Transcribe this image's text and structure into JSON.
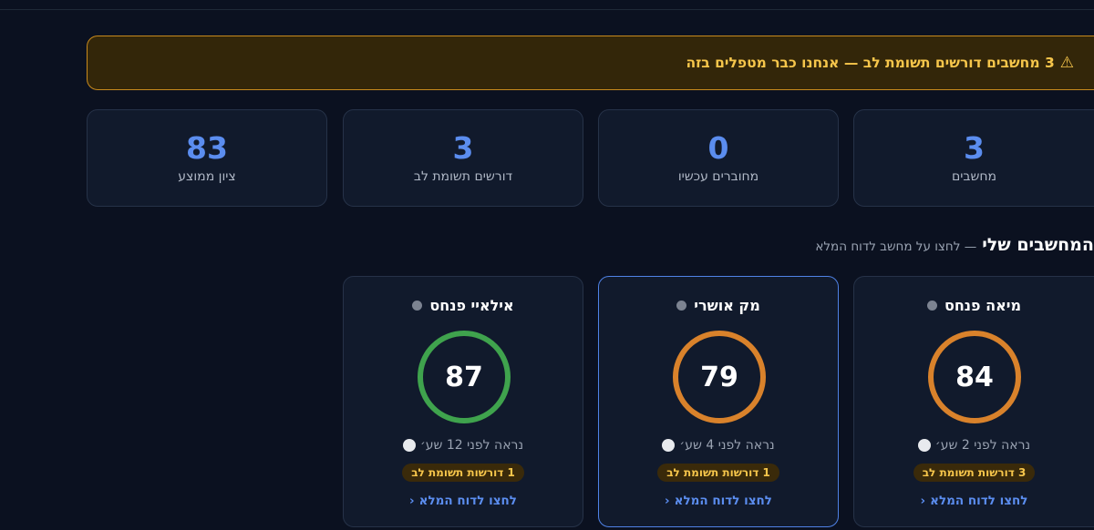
{
  "alert": {
    "icon": "warning-icon",
    "text": "3 מחשבים דורשים תשומת לב — אנחנו כבר מטפלים בזה"
  },
  "stats": [
    {
      "value": "3",
      "label": "מחשבים"
    },
    {
      "value": "0",
      "label": "מחוברים עכשיו"
    },
    {
      "value": "3",
      "label": "דורשים תשומת לב"
    },
    {
      "value": "83",
      "label": "ציון ממוצע"
    }
  ],
  "section": {
    "title": "המחשבים שלי",
    "subtitle": "— לחצו על מחשב לדוח המלא"
  },
  "computers": [
    {
      "name": "מיאה פנחס",
      "score": 84,
      "ring_color": "#d9822b",
      "seen": "נראה לפני 2 שע׳",
      "badge": "3 דורשות תשומת לב",
      "link": "לחצו לדוח המלא",
      "selected": false
    },
    {
      "name": "מק אושרי",
      "score": 79,
      "ring_color": "#d9822b",
      "seen": "נראה לפני 4 שע׳",
      "badge": "1 דורשות תשומת לב",
      "link": "לחצו לדוח המלא",
      "selected": true
    },
    {
      "name": "אילאיי פנחס",
      "score": 87,
      "ring_color": "#3fa34d",
      "seen": "נראה לפני 12 שע׳",
      "badge": "1 דורשות תשומת לב",
      "link": "לחצו לדוח המלא",
      "selected": false
    }
  ],
  "colors": {
    "accent": "#5b8def",
    "warning": "#f7c64b",
    "ring_ok": "#3fa34d",
    "ring_warn": "#d9822b"
  }
}
